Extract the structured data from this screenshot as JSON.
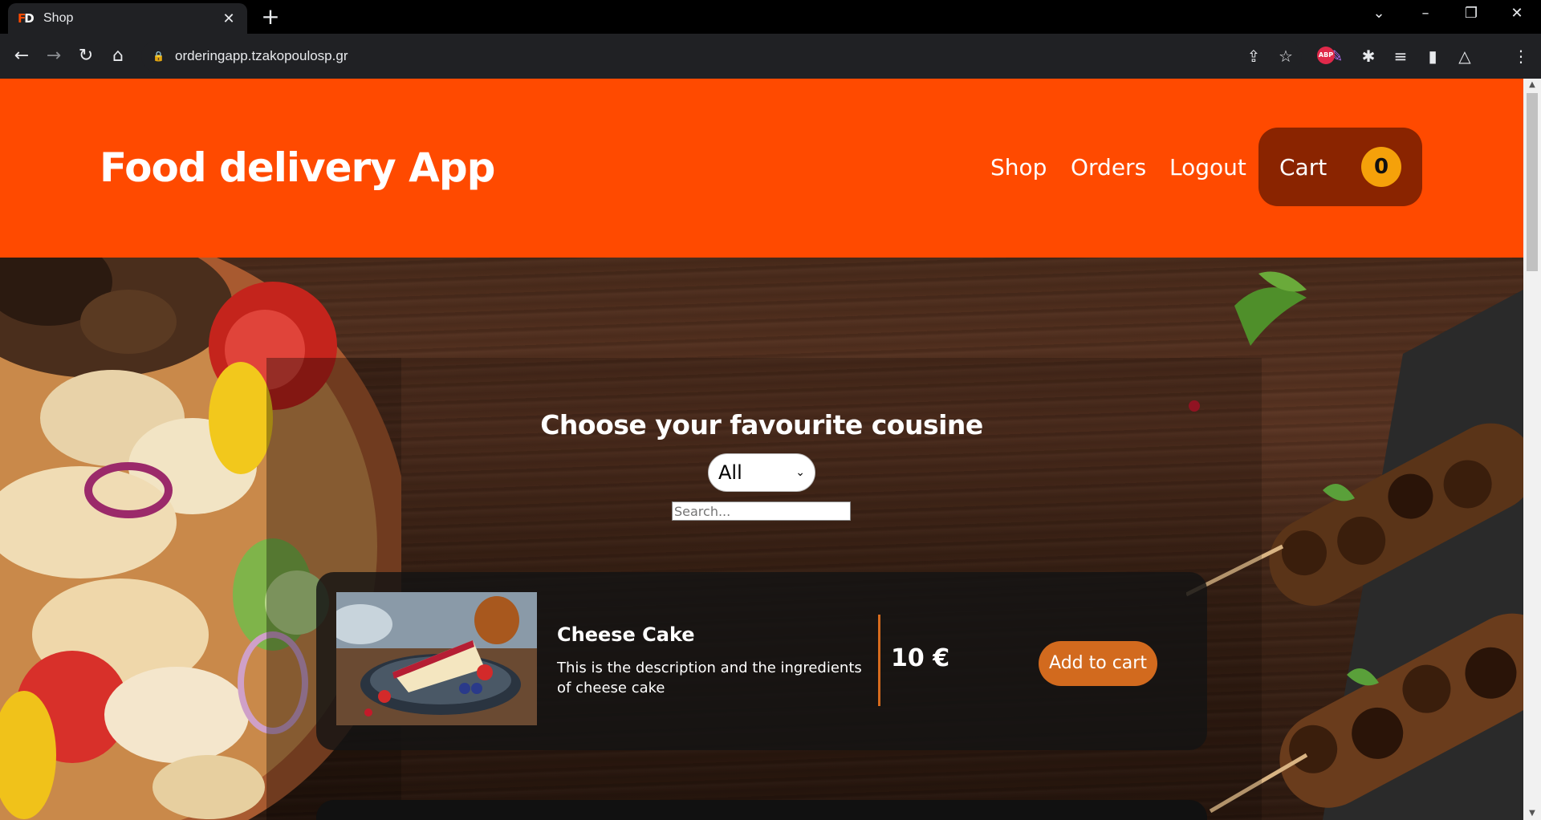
{
  "browser": {
    "tab_title": "Shop",
    "url": "orderingapp.tzakopoulosp.gr",
    "extension_abp": "ABP"
  },
  "header": {
    "brand": "Food delivery App",
    "nav": [
      "Shop",
      "Orders",
      "Logout"
    ],
    "cart_label": "Cart",
    "cart_count": "0"
  },
  "filter": {
    "heading": "Choose your favourite cousine",
    "category_selected": "All",
    "search_placeholder": "Search..."
  },
  "products": [
    {
      "name": "Cheese Cake",
      "description": "This is the description and the ingredients of cheese cake",
      "price": "10 €",
      "button_label": "Add to cart"
    }
  ],
  "colors": {
    "header_bg": "#ff4a00",
    "cart_bg": "#8a2400",
    "badge_bg": "#f5a10a",
    "accent": "#d26a1e"
  }
}
